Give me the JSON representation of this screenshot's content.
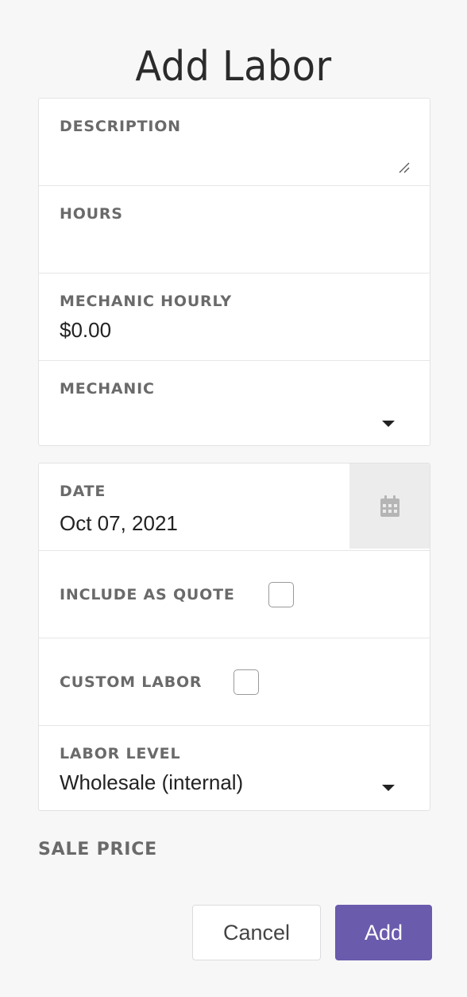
{
  "page": {
    "title": "Add Labor"
  },
  "card1": {
    "description": {
      "label": "DESCRIPTION",
      "value": ""
    },
    "hours": {
      "label": "HOURS",
      "value": ""
    },
    "mechanic_hourly": {
      "label": "MECHANIC HOURLY",
      "value": "$0.00"
    },
    "mechanic": {
      "label": "MECHANIC",
      "value": ""
    }
  },
  "card2": {
    "date": {
      "label": "DATE",
      "value": "Oct 07, 2021",
      "icon": "calendar-icon"
    },
    "include_as_quote": {
      "label": "INCLUDE AS QUOTE",
      "checked": false
    },
    "custom_labor": {
      "label": "CUSTOM LABOR",
      "checked": false
    },
    "labor_level": {
      "label": "LABOR LEVEL",
      "value": "Wholesale (internal)"
    }
  },
  "sale_price": {
    "label": "SALE PRICE"
  },
  "actions": {
    "cancel_label": "Cancel",
    "add_label": "Add"
  },
  "colors": {
    "accent": "#6b5bad",
    "background": "#f7f7f7",
    "label": "#6a6a6a"
  }
}
